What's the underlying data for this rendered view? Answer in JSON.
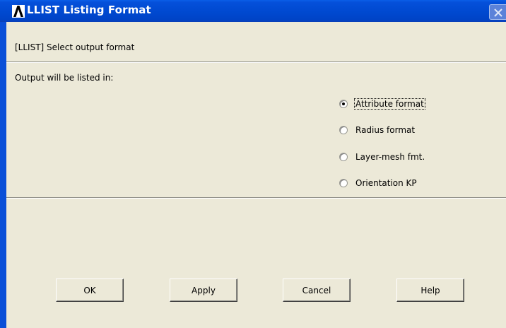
{
  "window": {
    "title": "LLIST Listing Format",
    "icon": "ansys-logo-icon",
    "close_icon": "close-icon"
  },
  "dialog": {
    "prompt": "[LLIST]  Select output format",
    "output_label": "Output will be listed in:",
    "options": [
      {
        "label": "Attribute format",
        "checked": true
      },
      {
        "label": "Radius format",
        "checked": false
      },
      {
        "label": "Layer-mesh fmt.",
        "checked": false
      },
      {
        "label": "Orientation KP",
        "checked": false
      }
    ],
    "selected": "Attribute format"
  },
  "buttons": {
    "ok": "OK",
    "apply": "Apply",
    "cancel": "Cancel",
    "help": "Help"
  },
  "colors": {
    "titlebar": "#0049d0",
    "dialog_bg": "#ece9d8"
  }
}
